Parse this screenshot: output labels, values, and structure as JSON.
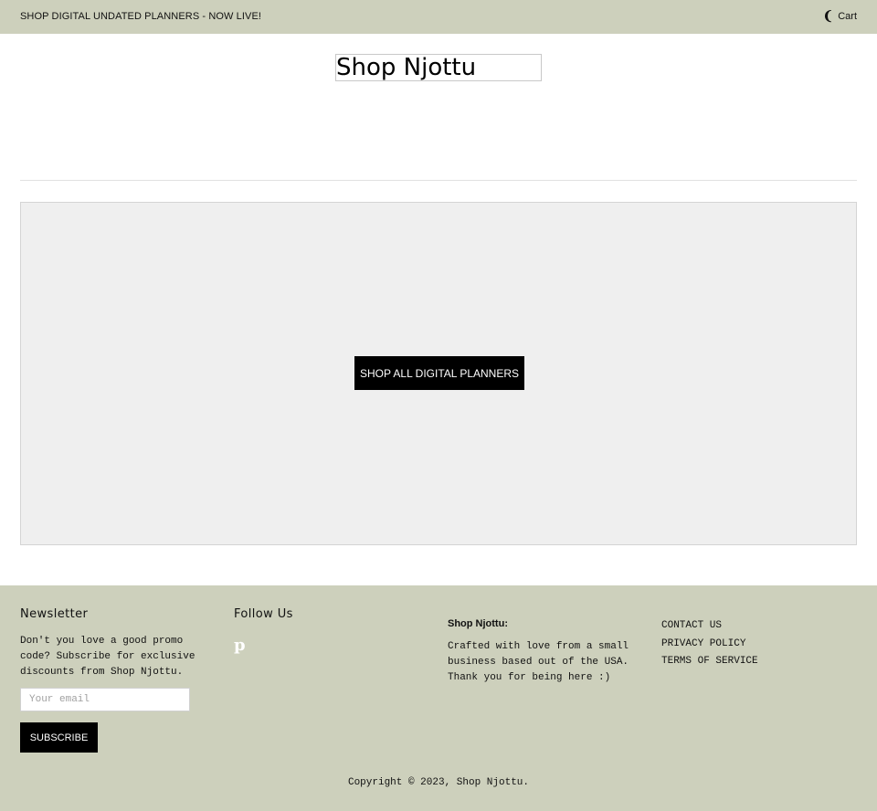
{
  "announcement": "SHOP DIGITAL UNDATED PLANNERS - NOW LIVE!",
  "cart": {
    "icon": "cart-bag-icon",
    "label": "Cart"
  },
  "logo": {
    "text": "Shop Njottu"
  },
  "hero": {
    "button_label": "SHOP ALL DIGITAL PLANNERS"
  },
  "footer": {
    "newsletter": {
      "title": "Newsletter",
      "text": "Don't you love a good promo code? Subscribe for exclusive discounts from Shop Njottu.",
      "email_placeholder": "Your email",
      "subscribe_label": "SUBSCRIBE"
    },
    "follow": {
      "title": "Follow Us",
      "icon": "pinterest-icon",
      "icon_glyph": "p"
    },
    "shop": {
      "heading": "Shop Njottu:",
      "text": "Crafted with love from a small business based out of the USA. Thank you for being here :)"
    },
    "links": [
      "CONTACT US",
      "PRIVACY POLICY",
      "TERMS OF SERVICE"
    ],
    "copyright": "Copyright © 2023, Shop Njottu."
  },
  "colors": {
    "bar_bg": "#cdd0bc",
    "hero_bg": "#efefef",
    "button_bg": "#000000"
  }
}
